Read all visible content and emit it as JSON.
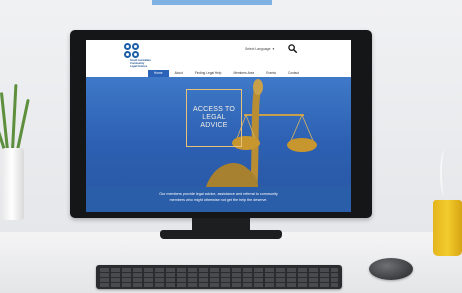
{
  "site": {
    "logo": {
      "line1": "South Australian",
      "line2": "Community",
      "line3": "Legal Centres"
    },
    "language_select": {
      "label": "Select Language",
      "chevron": "▾"
    },
    "search": {
      "icon": "search-icon"
    },
    "nav": [
      {
        "label": "Home",
        "active": true
      },
      {
        "label": "About",
        "active": false
      },
      {
        "label": "Finding Legal Help",
        "active": false
      },
      {
        "label": "Members Area",
        "active": false
      },
      {
        "label": "Events",
        "active": false
      },
      {
        "label": "Contact",
        "active": false
      }
    ],
    "hero": {
      "title_line1": "ACCESS TO",
      "title_line2": "LEGAL",
      "title_line3": "ADVICE",
      "description_line1": "Our members provide legal advice, assistance and referral to community",
      "description_line2": "members who might otherwise not get the help the deserve."
    }
  },
  "colors": {
    "accent": "#2a62b8",
    "hero_blue": "#3f79c8",
    "frame_gold": "#e6c27a",
    "mug_yellow": "#f3cc2c"
  },
  "objects": [
    "monitor",
    "keyboard",
    "mouse",
    "plant-pot",
    "coffee-mug"
  ]
}
